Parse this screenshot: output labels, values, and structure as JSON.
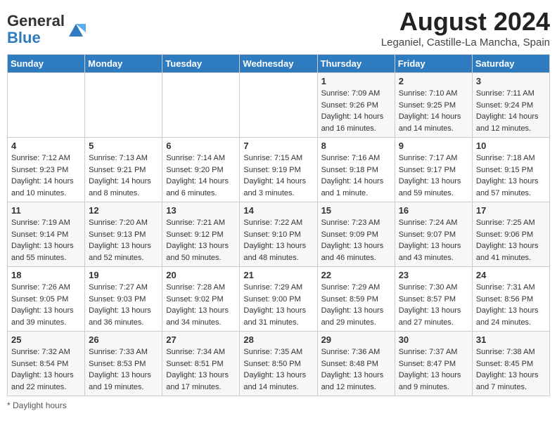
{
  "header": {
    "logo_general": "General",
    "logo_blue": "Blue",
    "month_year": "August 2024",
    "location": "Leganiel, Castille-La Mancha, Spain"
  },
  "days_of_week": [
    "Sunday",
    "Monday",
    "Tuesday",
    "Wednesday",
    "Thursday",
    "Friday",
    "Saturday"
  ],
  "weeks": [
    [
      {
        "day": "",
        "content": ""
      },
      {
        "day": "",
        "content": ""
      },
      {
        "day": "",
        "content": ""
      },
      {
        "day": "",
        "content": ""
      },
      {
        "day": "1",
        "content": "Sunrise: 7:09 AM\nSunset: 9:26 PM\nDaylight: 14 hours and 16 minutes."
      },
      {
        "day": "2",
        "content": "Sunrise: 7:10 AM\nSunset: 9:25 PM\nDaylight: 14 hours and 14 minutes."
      },
      {
        "day": "3",
        "content": "Sunrise: 7:11 AM\nSunset: 9:24 PM\nDaylight: 14 hours and 12 minutes."
      }
    ],
    [
      {
        "day": "4",
        "content": "Sunrise: 7:12 AM\nSunset: 9:23 PM\nDaylight: 14 hours and 10 minutes."
      },
      {
        "day": "5",
        "content": "Sunrise: 7:13 AM\nSunset: 9:21 PM\nDaylight: 14 hours and 8 minutes."
      },
      {
        "day": "6",
        "content": "Sunrise: 7:14 AM\nSunset: 9:20 PM\nDaylight: 14 hours and 6 minutes."
      },
      {
        "day": "7",
        "content": "Sunrise: 7:15 AM\nSunset: 9:19 PM\nDaylight: 14 hours and 3 minutes."
      },
      {
        "day": "8",
        "content": "Sunrise: 7:16 AM\nSunset: 9:18 PM\nDaylight: 14 hours and 1 minute."
      },
      {
        "day": "9",
        "content": "Sunrise: 7:17 AM\nSunset: 9:17 PM\nDaylight: 13 hours and 59 minutes."
      },
      {
        "day": "10",
        "content": "Sunrise: 7:18 AM\nSunset: 9:15 PM\nDaylight: 13 hours and 57 minutes."
      }
    ],
    [
      {
        "day": "11",
        "content": "Sunrise: 7:19 AM\nSunset: 9:14 PM\nDaylight: 13 hours and 55 minutes."
      },
      {
        "day": "12",
        "content": "Sunrise: 7:20 AM\nSunset: 9:13 PM\nDaylight: 13 hours and 52 minutes."
      },
      {
        "day": "13",
        "content": "Sunrise: 7:21 AM\nSunset: 9:12 PM\nDaylight: 13 hours and 50 minutes."
      },
      {
        "day": "14",
        "content": "Sunrise: 7:22 AM\nSunset: 9:10 PM\nDaylight: 13 hours and 48 minutes."
      },
      {
        "day": "15",
        "content": "Sunrise: 7:23 AM\nSunset: 9:09 PM\nDaylight: 13 hours and 46 minutes."
      },
      {
        "day": "16",
        "content": "Sunrise: 7:24 AM\nSunset: 9:07 PM\nDaylight: 13 hours and 43 minutes."
      },
      {
        "day": "17",
        "content": "Sunrise: 7:25 AM\nSunset: 9:06 PM\nDaylight: 13 hours and 41 minutes."
      }
    ],
    [
      {
        "day": "18",
        "content": "Sunrise: 7:26 AM\nSunset: 9:05 PM\nDaylight: 13 hours and 39 minutes."
      },
      {
        "day": "19",
        "content": "Sunrise: 7:27 AM\nSunset: 9:03 PM\nDaylight: 13 hours and 36 minutes."
      },
      {
        "day": "20",
        "content": "Sunrise: 7:28 AM\nSunset: 9:02 PM\nDaylight: 13 hours and 34 minutes."
      },
      {
        "day": "21",
        "content": "Sunrise: 7:29 AM\nSunset: 9:00 PM\nDaylight: 13 hours and 31 minutes."
      },
      {
        "day": "22",
        "content": "Sunrise: 7:29 AM\nSunset: 8:59 PM\nDaylight: 13 hours and 29 minutes."
      },
      {
        "day": "23",
        "content": "Sunrise: 7:30 AM\nSunset: 8:57 PM\nDaylight: 13 hours and 27 minutes."
      },
      {
        "day": "24",
        "content": "Sunrise: 7:31 AM\nSunset: 8:56 PM\nDaylight: 13 hours and 24 minutes."
      }
    ],
    [
      {
        "day": "25",
        "content": "Sunrise: 7:32 AM\nSunset: 8:54 PM\nDaylight: 13 hours and 22 minutes."
      },
      {
        "day": "26",
        "content": "Sunrise: 7:33 AM\nSunset: 8:53 PM\nDaylight: 13 hours and 19 minutes."
      },
      {
        "day": "27",
        "content": "Sunrise: 7:34 AM\nSunset: 8:51 PM\nDaylight: 13 hours and 17 minutes."
      },
      {
        "day": "28",
        "content": "Sunrise: 7:35 AM\nSunset: 8:50 PM\nDaylight: 13 hours and 14 minutes."
      },
      {
        "day": "29",
        "content": "Sunrise: 7:36 AM\nSunset: 8:48 PM\nDaylight: 13 hours and 12 minutes."
      },
      {
        "day": "30",
        "content": "Sunrise: 7:37 AM\nSunset: 8:47 PM\nDaylight: 13 hours and 9 minutes."
      },
      {
        "day": "31",
        "content": "Sunrise: 7:38 AM\nSunset: 8:45 PM\nDaylight: 13 hours and 7 minutes."
      }
    ]
  ],
  "footer": {
    "note": "Daylight hours"
  }
}
